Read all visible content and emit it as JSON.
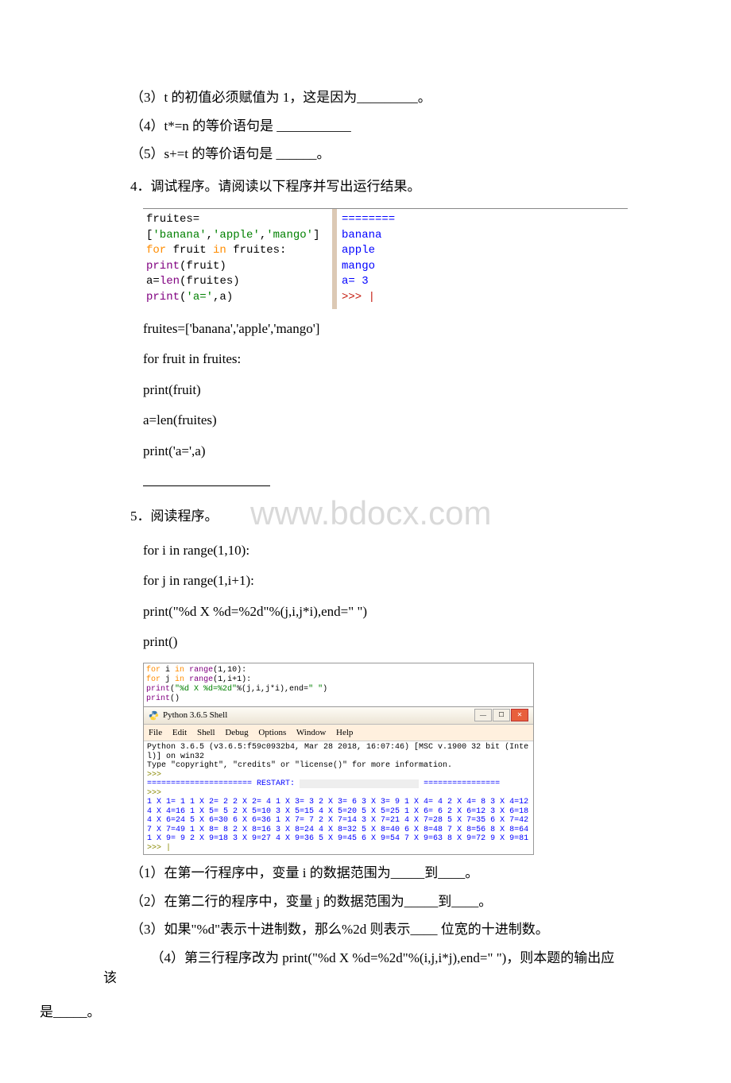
{
  "q3": {
    "lines": [
      "（3）t 的初值必须赋值为 1，这是因为_________。",
      "（4）t*=n 的等价语句是 ___________",
      "（5）s+=t 的等价语句是 ______。"
    ]
  },
  "q4": {
    "title": "4．调试程序。请阅读以下程序并写出运行结果。",
    "code_lines": {
      "l1_a": "fruites=[",
      "l1_b": "'banana'",
      "l1_c": ",",
      "l1_d": "'apple'",
      "l1_e": ",",
      "l1_f": "'mango'",
      "l1_g": "]",
      "l2_a": "for",
      "l2_b": " fruit ",
      "l2_c": "in",
      "l2_d": " fruites:",
      "l3_a": "  ",
      "l3_b": "print",
      "l3_c": "(fruit)",
      "l4_a": "a=",
      "l4_b": "len",
      "l4_c": "(fruites)",
      "l5_a": "print",
      "l5_b": "(",
      "l5_c": "'a='",
      "l5_d": ",a)"
    },
    "output": {
      "sep": "========",
      "o1": "banana",
      "o2": "apple",
      "o3": "mango",
      "o4": "a= 3",
      "o5": ">>> |"
    },
    "plain": [
      "fruites=['banana','apple','mango']",
      "for fruit in fruites:",
      " print(fruit)",
      "a=len(fruites)",
      "print('a=',a)"
    ]
  },
  "q5": {
    "title": "5．阅读程序。",
    "code": [
      "for i in range(1,10):",
      " for j in range(1,i+1):",
      " print(\"%d X %d=%2d\"%(j,i,j*i),end=\" \")",
      "print()"
    ],
    "shell_code": {
      "l1_a": "for",
      "l1_b": " i ",
      "l1_c": "in",
      "l1_d": " ",
      "l1_e": "range",
      "l1_f": "(1,10):",
      "l2_a": "  for",
      "l2_b": " j ",
      "l2_c": "in",
      "l2_d": " ",
      "l2_e": "range",
      "l2_f": "(1,i+1):",
      "l3_a": "    ",
      "l3_b": "print",
      "l3_c": "(",
      "l3_d": "\"%d X %d=%2d\"",
      "l3_e": "%(j,i,j*i),end=",
      "l3_f": "\" \"",
      "l3_g": ")",
      "l4_a": "print",
      "l4_b": "()"
    },
    "shell": {
      "title": "Python 3.6.5 Shell",
      "menu": [
        "File",
        "Edit",
        "Shell",
        "Debug",
        "Options",
        "Window",
        "Help"
      ],
      "banner1": "Python 3.6.5 (v3.6.5:f59c0932b4, Mar 28 2018, 16:07:46) [MSC v.1900 32 bit (Intel)] on win32",
      "banner2": "Type \"copyright\", \"credits\" or \"license()\" for more information.",
      "prompt": ">>>",
      "restart": "====================== RESTART: ",
      "restart_tail": " ================",
      "output": "1 X 1= 1 1 X 2= 2 2 X 2= 4 1 X 3= 3 2 X 3= 6 3 X 3= 9 1 X 4= 4 2 X 4= 8 3 X 4=12 4 X 4=16 1 X 5= 5 2 X 5=10 3 X 5=15 4 X 5=20 5 X 5=25 1 X 6= 6 2 X 6=12 3 X 6=18 4 X 6=24 5 X 6=30 6 X 6=36 1 X 7= 7 2 X 7=14 3 X 7=21 4 X 7=28 5 X 7=35 6 X 7=42 7 X 7=49 1 X 8= 8 2 X 8=16 3 X 8=24 4 X 8=32 5 X 8=40 6 X 8=48 7 X 8=56 8 X 8=64 1 X 9= 9 2 X 9=18 3 X 9=27 4 X 9=36 5 X 9=45 6 X 9=54 7 X 9=63 8 X 9=72 9 X 9=81",
      "prompt2": ">>> |"
    },
    "subs": [
      "（1）在第一行程序中，变量 i 的数据范围为_____到____。",
      "（2）在第二行的程序中，变量 j 的数据范围为_____到____。",
      "（3）如果\"%d\"表示十进制数，那么%2d 则表示____ 位宽的十进制数。"
    ],
    "sub4a": "　　（4）第三行程序改为 print(\"%d X %d=%2d\"%(i,j,i*j),end=\" \")，则本题的输出应该",
    "sub4b": "是_____。"
  },
  "watermark": "www.bdocx.com"
}
